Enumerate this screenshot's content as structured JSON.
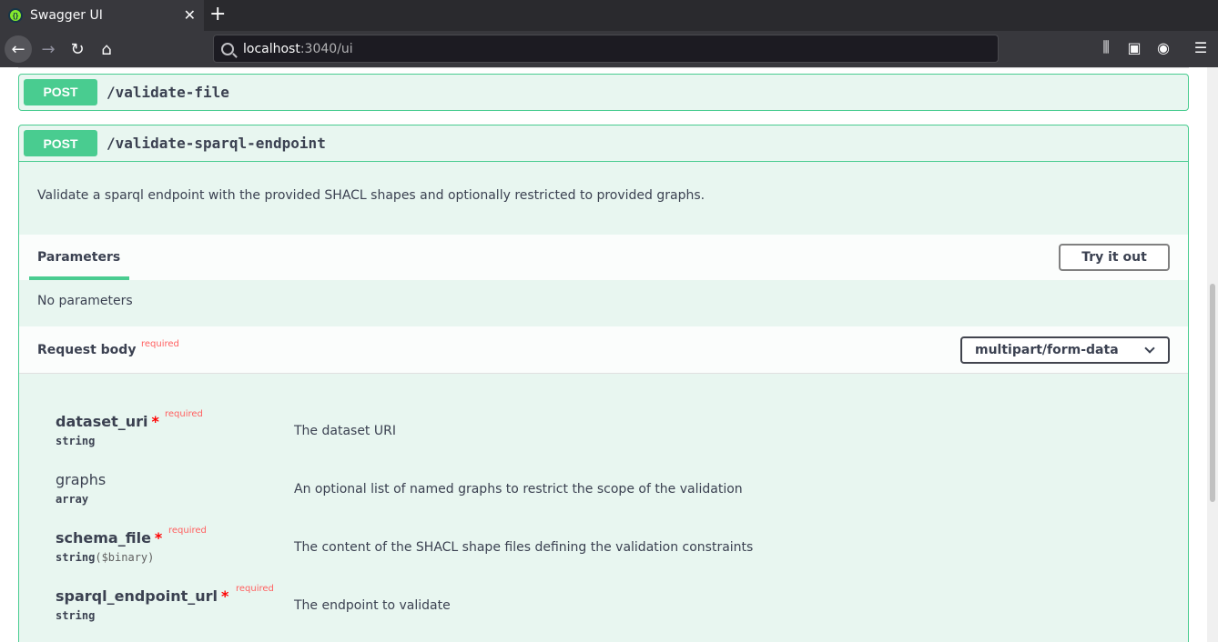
{
  "browser": {
    "tab_title": "Swagger UI",
    "url_host": "localhost",
    "url_rest": ":3040/ui"
  },
  "ops": [
    {
      "method": "POST",
      "path": "/validate-file"
    },
    {
      "method": "POST",
      "path": "/validate-sparql-endpoint",
      "description": "Validate a sparql endpoint with the provided SHACL shapes and optionally restricted to provided graphs.",
      "parameters_label": "Parameters",
      "try_label": "Try it out",
      "no_params": "No parameters",
      "request_body_label": "Request body",
      "request_body_required": "required",
      "content_type": "multipart/form-data",
      "fields": [
        {
          "name": "dataset_uri",
          "required": "required",
          "type": "string",
          "format": "",
          "description": "The dataset URI"
        },
        {
          "name": "graphs",
          "required": "",
          "type": "array",
          "format": "",
          "description": "An optional list of named graphs to restrict the scope of the validation"
        },
        {
          "name": "schema_file",
          "required": "required",
          "type": "string",
          "format": "($binary)",
          "description": "The content of the SHACL shape files defining the validation constraints"
        },
        {
          "name": "sparql_endpoint_url",
          "required": "required",
          "type": "string",
          "format": "",
          "description": "The endpoint to validate"
        }
      ]
    }
  ],
  "colors": {
    "post": "#49cc90",
    "post_bg": "#e8f6f0",
    "required": "#ff6060"
  },
  "icons": [
    "swagger-favicon",
    "close-icon",
    "plus-icon",
    "back-arrow-icon",
    "forward-arrow-icon",
    "reload-icon",
    "home-icon",
    "search-icon",
    "library-icon",
    "sidebar-icon",
    "account-icon",
    "menu-icon",
    "chevron-down-icon"
  ]
}
